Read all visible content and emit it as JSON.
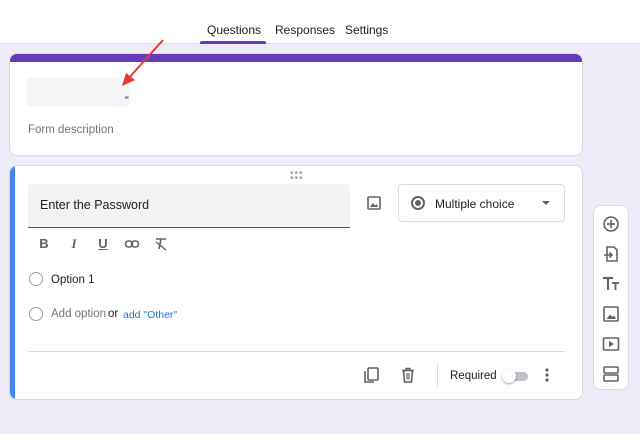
{
  "tabs": [
    {
      "label": "Questions",
      "active": true
    },
    {
      "label": "Responses",
      "active": false
    },
    {
      "label": "Settings",
      "active": false
    }
  ],
  "header": {
    "accent_color": "#673ab7",
    "description_placeholder": "Form description"
  },
  "question": {
    "title": "Enter the Password",
    "type": "Multiple choice",
    "options": [
      {
        "label": "Option 1"
      }
    ],
    "add_option": "Add option",
    "or": "or",
    "add_other": "add \"Other\"",
    "required_label": "Required",
    "required": false,
    "accent_color": "#4285f4"
  },
  "formatting": [
    "bold-icon",
    "italic-icon",
    "underline-icon",
    "link-icon",
    "clear-format-icon"
  ],
  "side_toolbar": [
    "add-question-icon",
    "import-questions-icon",
    "title-text-icon",
    "add-image-icon",
    "add-video-icon",
    "add-section-icon"
  ]
}
